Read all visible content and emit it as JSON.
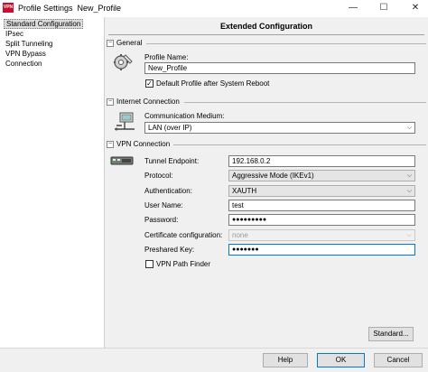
{
  "window": {
    "app_icon_text": "VPN",
    "title": "Profile Settings",
    "profile_name": "New_Profile",
    "minimize_glyph": "—",
    "maximize_glyph": "☐",
    "close_glyph": "✕"
  },
  "sidebar": {
    "items": [
      {
        "label": "Standard Configuration",
        "selected": true
      },
      {
        "label": "IPsec"
      },
      {
        "label": "Split Tunneling"
      },
      {
        "label": "VPN Bypass"
      },
      {
        "label": "Connection"
      }
    ]
  },
  "main": {
    "title": "Extended Configuration",
    "collapse_glyph": "−",
    "general": {
      "title": "General",
      "profile_name_label": "Profile Name:",
      "profile_name_value": "New_Profile",
      "default_profile_label": "Default Profile after System Reboot",
      "default_profile_checked": true,
      "check_glyph": "✓"
    },
    "internet": {
      "title": "Internet Connection",
      "medium_label": "Communication Medium:",
      "medium_value": "LAN (over IP)"
    },
    "vpn": {
      "title": "VPN Connection",
      "tunnel_endpoint_label": "Tunnel Endpoint:",
      "tunnel_endpoint_value": "192.168.0.2",
      "protocol_label": "Protocol:",
      "protocol_value": "Aggressive Mode (IKEv1)",
      "authentication_label": "Authentication:",
      "authentication_value": "XAUTH",
      "username_label": "User Name:",
      "username_value": "test",
      "password_label": "Password:",
      "password_value": "●●●●●●●●●",
      "certificate_label": "Certificate configuration:",
      "certificate_value": "none",
      "preshared_label": "Preshared Key:",
      "preshared_value": "●●●●●●●",
      "path_finder_label": "VPN Path Finder",
      "path_finder_checked": false
    },
    "standard_button": "Standard..."
  },
  "footer": {
    "help": "Help",
    "ok": "OK",
    "cancel": "Cancel"
  },
  "caret_glyph": "⌵",
  "colors": {
    "app_icon": "#c8102e",
    "focus_border": "#0078d7"
  }
}
